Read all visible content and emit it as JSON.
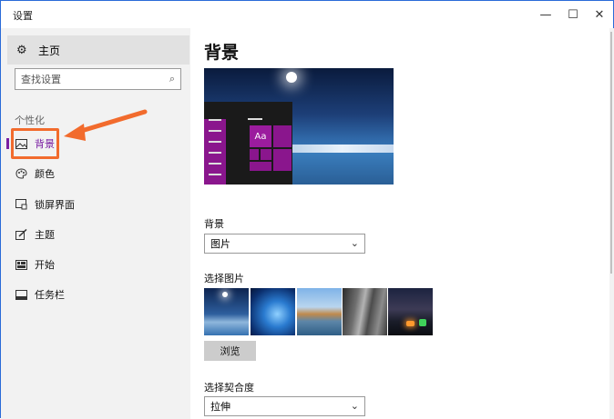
{
  "window": {
    "title": "设置",
    "minimize_glyph": "—",
    "maximize_glyph": "☐",
    "close_glyph": "✕"
  },
  "sidebar": {
    "home_label": "主页",
    "home_icon": "gear-icon",
    "search_placeholder": "查找设置",
    "search_icon": "search-icon",
    "section_label": "个性化",
    "items": [
      {
        "label": "背景",
        "icon": "picture-icon",
        "active": true
      },
      {
        "label": "颜色",
        "icon": "palette-icon",
        "active": false
      },
      {
        "label": "锁屏界面",
        "icon": "lock-screen-icon",
        "active": false
      },
      {
        "label": "主题",
        "icon": "brush-icon",
        "active": false
      },
      {
        "label": "开始",
        "icon": "start-grid-icon",
        "active": false
      },
      {
        "label": "任务栏",
        "icon": "taskbar-icon",
        "active": false
      }
    ],
    "accent_color": "#7a1fa2",
    "highlight_color": "#f26b2d"
  },
  "main": {
    "page_title": "背景",
    "preview_tile_text": "Aa",
    "background_label": "背景",
    "background_value": "图片",
    "choose_picture_label": "选择图片",
    "thumbnails": [
      "lake-night",
      "windows-blue",
      "beach-rocks",
      "rock-cliff",
      "milky-way-tent"
    ],
    "browse_label": "浏览",
    "fit_label": "选择契合度",
    "fit_value": "拉伸"
  }
}
